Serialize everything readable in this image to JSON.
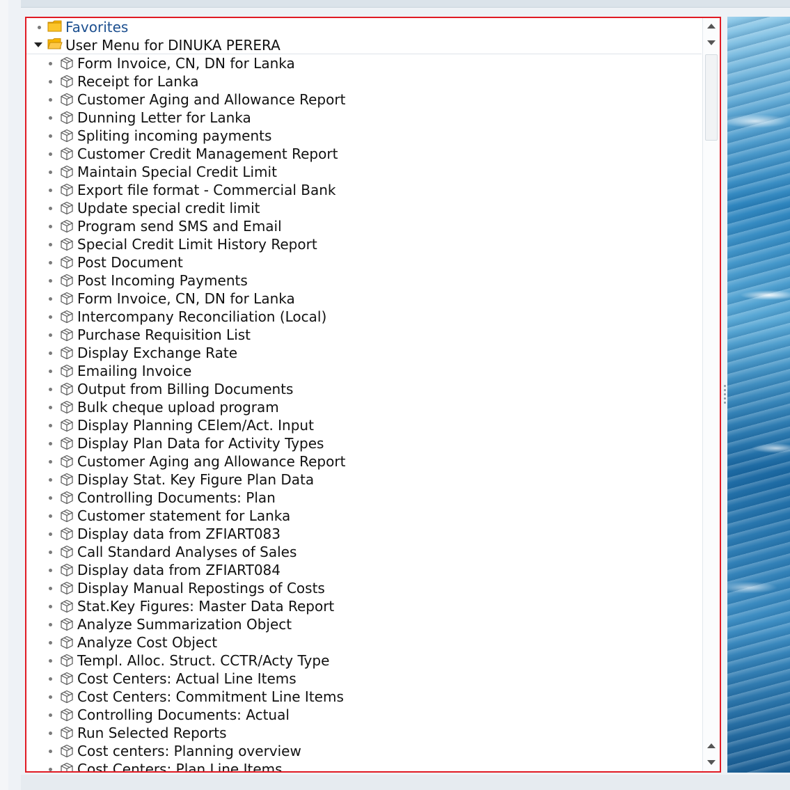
{
  "tree": {
    "favorites_label": "Favorites",
    "user_menu_label": "User Menu for DINUKA PERERA",
    "items": [
      "Form Invoice, CN, DN for Lanka",
      "Receipt for Lanka",
      "Customer Aging and Allowance Report",
      "Dunning Letter for Lanka",
      "Spliting incoming payments",
      "Customer Credit Management Report",
      "Maintain Special Credit Limit",
      "Export file format - Commercial Bank",
      "Update special credit limit",
      "Program send SMS and Email",
      "Special Credit Limit History Report",
      "Post Document",
      "Post Incoming Payments",
      "Form Invoice, CN, DN for Lanka",
      "Intercompany Reconciliation (Local)",
      "Purchase Requisition List",
      "Display Exchange Rate",
      "Emailing Invoice",
      "Output from Billing Documents",
      "Bulk cheque upload program",
      "Display Planning CElem/Act. Input",
      "Display Plan Data for Activity Types",
      "Customer Aging ang Allowance Report",
      "Display Stat. Key Figure Plan Data",
      "Controlling Documents: Plan",
      "Customer statement for Lanka",
      "Display data from ZFIART083",
      "Call Standard Analyses of Sales",
      "Display data from ZFIART084",
      "Display Manual Repostings of Costs",
      "Stat.Key Figures: Master Data Report",
      "Analyze Summarization Object",
      "Analyze Cost Object",
      "Templ. Alloc. Struct. CCTR/Acty Type",
      "Cost Centers: Actual Line Items",
      "Cost Centers: Commitment Line Items",
      "Controlling Documents: Actual",
      "Run Selected Reports",
      "Cost centers: Planning overview",
      "Cost Centers: Plan Line Items"
    ]
  },
  "icons": {
    "folder": "folder-icon",
    "folder_open": "folder-open-icon",
    "transaction": "transaction-cube-icon",
    "expand": "expand-arrow-icon",
    "bullet": "node-bullet-icon"
  },
  "colors": {
    "selection_border": "#e01b24",
    "favorites_text": "#1c4f8f",
    "folder_fill": "#f5b400"
  }
}
